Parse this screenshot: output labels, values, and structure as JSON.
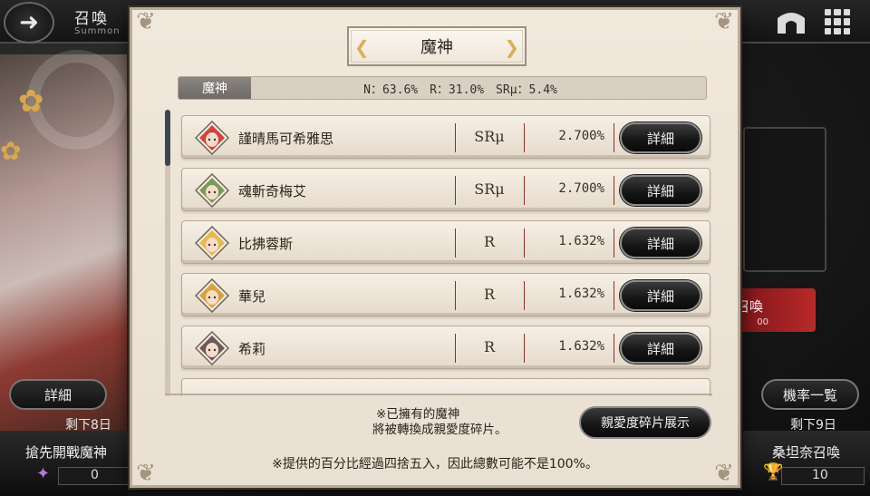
{
  "header": {
    "title": "召喚",
    "subtitle": "Summon",
    "icons": [
      "back-arrow-icon",
      "home-gate-icon",
      "grid-menu-icon"
    ]
  },
  "left_panel": {
    "detail_button": "詳細",
    "remaining": "剩下8日",
    "name": "搶先開戰魔神",
    "count": "0"
  },
  "right_panel": {
    "rates_button": "機率一覧",
    "remaining": "剩下9日",
    "name": "桑坦奈召喚",
    "count": "10",
    "red_button_label": "召喚",
    "red_button_sub": "00"
  },
  "modal": {
    "title": "魔神",
    "rate_bar": {
      "label": "魔神",
      "text": "N：63.6%　R：31.0%　SRμ：5.4%"
    },
    "rows": [
      {
        "name": "謹晴馬可希雅思",
        "rarity": "SRμ",
        "pct": "2.700%",
        "button": "詳細",
        "hair": "#d8403c"
      },
      {
        "name": "魂斬奇梅艾",
        "rarity": "SRμ",
        "pct": "2.700%",
        "button": "詳細",
        "hair": "#7a9a5c"
      },
      {
        "name": "比拂蓉斯",
        "rarity": "R",
        "pct": "1.632%",
        "button": "詳細",
        "hair": "#e7b84a"
      },
      {
        "name": "華兒",
        "rarity": "R",
        "pct": "1.632%",
        "button": "詳細",
        "hair": "#d8a43a"
      },
      {
        "name": "希莉",
        "rarity": "R",
        "pct": "1.632%",
        "button": "詳細",
        "hair": "#6d5a5a"
      }
    ],
    "note_line1": "※已擁有的魔神",
    "note_line2": "將被轉換成親愛度碎片。",
    "affinity_button": "親愛度碎片展示",
    "footnote": "※提供的百分比經過四捨五入，因此總數可能不是100%。"
  }
}
